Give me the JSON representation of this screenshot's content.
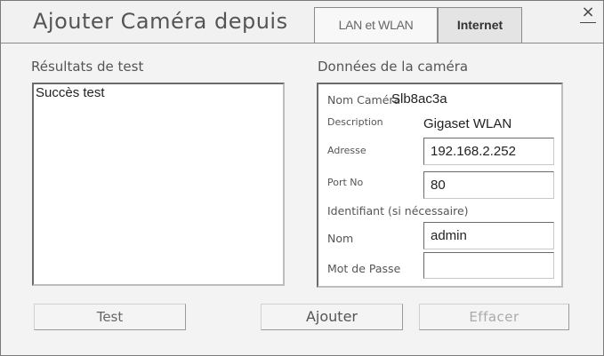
{
  "dialog": {
    "title": "Ajouter Caméra depuis",
    "tabs": [
      {
        "label": "LAN et WLAN",
        "active": false
      },
      {
        "label": "Internet",
        "active": true
      }
    ],
    "close_label": "×"
  },
  "results": {
    "label": "Résultats de test",
    "text": "Succès test"
  },
  "camera": {
    "label": "Données de la caméra",
    "name_label": "Nom Caméra",
    "name_value": "Slb8ac3a",
    "description_label": "Description",
    "description_value": "Gigaset WLAN",
    "address_label": "Adresse",
    "address_value": "192.168.2.252",
    "port_label": "Port No",
    "port_value": "80",
    "identifier_label": "Identifiant (si nécessaire)",
    "user_label": "Nom",
    "user_value": "admin",
    "password_label": "Mot de Passe",
    "password_value": ""
  },
  "buttons": {
    "test": "Test",
    "add": "Ajouter",
    "clear": "Effacer"
  },
  "colors": {
    "header_bg": "#f1f1f1",
    "body_bg": "#f3f3f3",
    "active_tab_bg": "#e4e4e4",
    "disabled_text": "#aaaaaa"
  }
}
